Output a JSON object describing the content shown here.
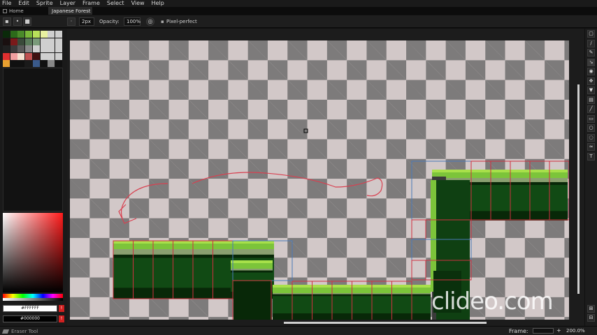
{
  "menu": [
    "File",
    "Edit",
    "Sprite",
    "Layer",
    "Frame",
    "Select",
    "View",
    "Help"
  ],
  "tabs": [
    {
      "label": "Home",
      "icon": "home-icon",
      "active": false
    },
    {
      "label": "Japanese Forest",
      "icon": "sprite-icon",
      "active": true
    }
  ],
  "context_bar": {
    "brush_size": "2px",
    "opacity_label": "Opacity:",
    "opacity_value": "100%",
    "pixel_perfect_label": "Pixel-perfect"
  },
  "palette": {
    "swatches": [
      "#0a2a0a",
      "#2c6a1a",
      "#4a8a2a",
      "#7ab83a",
      "#b8e05a",
      "#e8f0a0",
      "#cfcfcf",
      "#cfcfcf",
      "#1a1010",
      "#7a1a1a",
      "#3a4a3a",
      "#5a7a5a",
      "#7a9a7a",
      "#cfcfcf",
      "#cfcfcf",
      "#cfcfcf",
      "#202020",
      "#3a3a3a",
      "#5a5a5a",
      "#8a8a8a",
      "#cfcfcf",
      "#cfcfcf",
      "#cfcfcf",
      "#cfcfcf",
      "#e03030",
      "#f0a0a0",
      "#f5e0d0",
      "#c05050",
      "#401010",
      "#cfcfcf",
      "#cfcfcf",
      "#cfcfcf",
      "#e8a030",
      "#101010",
      "#101010",
      "#1a1a1a",
      "#3a5a8a",
      "#101010",
      "#888888",
      "#101010"
    ]
  },
  "colors": {
    "foreground": "#FFFFFF",
    "background": "#000000",
    "accent_red": "#d02020"
  },
  "status": {
    "tool": "Eraser Tool",
    "frame_label": "Frame:",
    "zoom": "200.0%"
  },
  "tools": [
    "marquee-icon",
    "lasso-icon",
    "pencil-icon",
    "eyedropper-icon",
    "zoom-icon",
    "move-icon",
    "fill-icon",
    "gradient-icon",
    "line-icon",
    "rectangle-icon",
    "ellipse-icon",
    "contour-icon",
    "blur-icon",
    "text-icon"
  ],
  "watermark": "clideo.com"
}
